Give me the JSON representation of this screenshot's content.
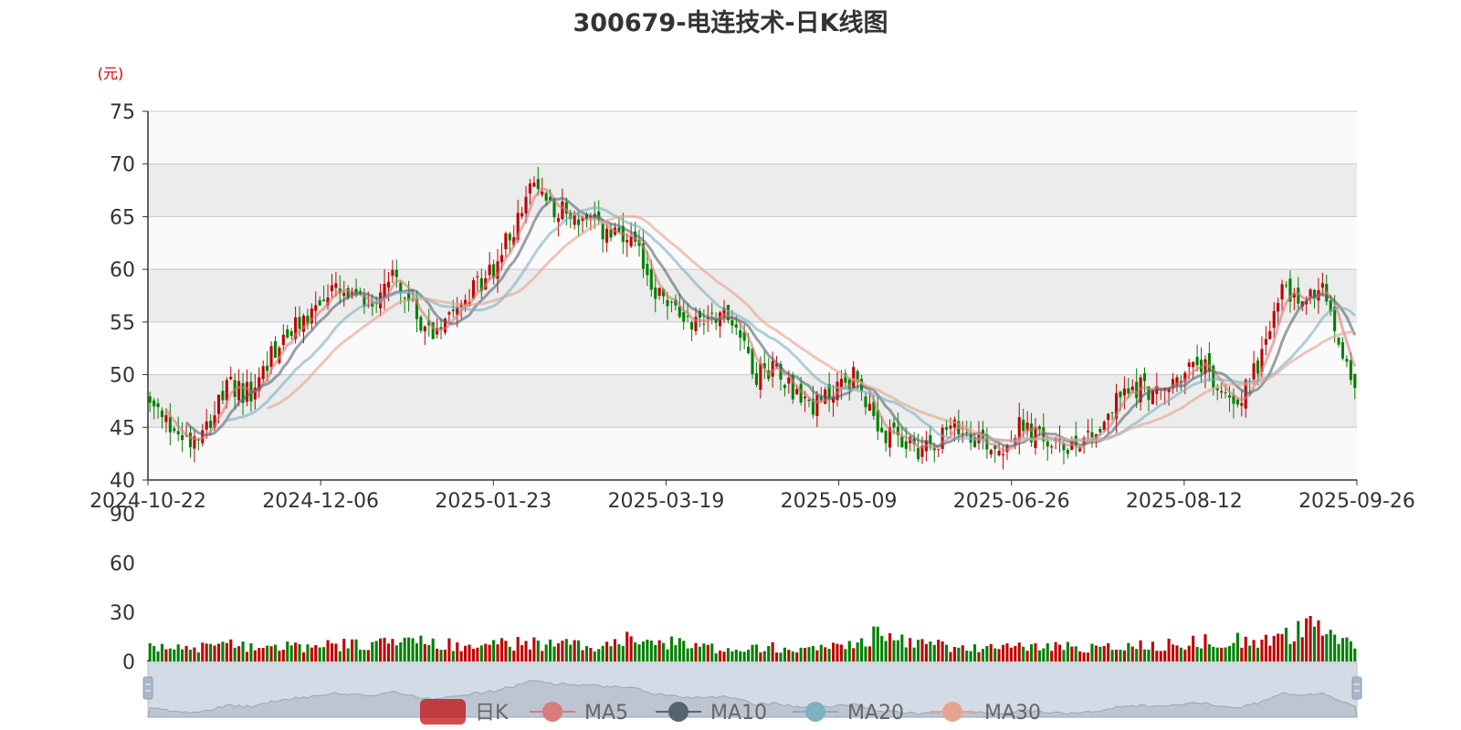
{
  "chart_data": {
    "type": "candlestick",
    "title": "300679-电连技术-日K线图",
    "price_unit": "(元)",
    "price_axis": {
      "ylim": [
        40,
        75
      ],
      "ticks": [
        40,
        45,
        50,
        55,
        60,
        65,
        70,
        75
      ]
    },
    "volume_axis": {
      "ylim": [
        0,
        90
      ],
      "ticks": [
        0,
        30,
        60,
        90
      ]
    },
    "x_ticks": [
      "2024-10-22",
      "2024-12-06",
      "2025-01-23",
      "2025-03-19",
      "2025-05-09",
      "2025-06-26",
      "2025-08-12",
      "2025-09-26"
    ],
    "legend": [
      "日K",
      "MA5",
      "MA10",
      "MA20",
      "MA30"
    ],
    "colors": {
      "up": "#c00000",
      "down": "#008000",
      "MA5": "#d87c7c",
      "MA10": "#546570",
      "MA20": "#7eb0bf",
      "MA30": "#e5a48d",
      "grid_band": "#ececec",
      "axis": "#333333",
      "title": "#333333",
      "unit": "#d00000",
      "zoom_bg": "#d3dbe6"
    },
    "grid": true,
    "legend_position": "bottom-center",
    "close_series_anchors": [
      [
        0,
        47
      ],
      [
        5,
        45
      ],
      [
        10,
        44
      ],
      [
        15,
        46
      ],
      [
        20,
        49
      ],
      [
        25,
        48
      ],
      [
        30,
        52
      ],
      [
        35,
        54
      ],
      [
        40,
        56
      ],
      [
        45,
        58
      ],
      [
        50,
        57
      ],
      [
        55,
        57
      ],
      [
        60,
        60
      ],
      [
        65,
        56
      ],
      [
        70,
        54
      ],
      [
        75,
        57
      ],
      [
        80,
        58
      ],
      [
        85,
        60
      ],
      [
        90,
        64
      ],
      [
        95,
        68
      ],
      [
        100,
        66
      ],
      [
        105,
        65
      ],
      [
        110,
        64
      ],
      [
        115,
        63
      ],
      [
        120,
        62
      ],
      [
        125,
        58
      ],
      [
        130,
        56
      ],
      [
        135,
        55
      ],
      [
        140,
        56
      ],
      [
        145,
        55
      ],
      [
        150,
        50
      ],
      [
        155,
        51
      ],
      [
        160,
        48
      ],
      [
        165,
        47
      ],
      [
        170,
        49
      ],
      [
        175,
        50
      ],
      [
        180,
        44
      ],
      [
        185,
        44
      ],
      [
        190,
        43
      ],
      [
        195,
        44
      ],
      [
        200,
        45
      ],
      [
        205,
        44
      ],
      [
        210,
        43
      ],
      [
        215,
        45
      ],
      [
        220,
        44
      ],
      [
        225,
        43
      ],
      [
        230,
        44
      ],
      [
        235,
        45
      ],
      [
        240,
        48
      ],
      [
        245,
        49
      ],
      [
        250,
        48
      ],
      [
        255,
        50
      ],
      [
        260,
        51
      ],
      [
        265,
        48
      ],
      [
        270,
        48
      ],
      [
        275,
        52
      ],
      [
        280,
        58
      ],
      [
        285,
        57
      ],
      [
        290,
        58
      ],
      [
        295,
        52
      ],
      [
        298,
        49
      ]
    ],
    "volume_anchors": [
      [
        0,
        8
      ],
      [
        20,
        10
      ],
      [
        40,
        9
      ],
      [
        60,
        12
      ],
      [
        80,
        10
      ],
      [
        90,
        11
      ],
      [
        110,
        10
      ],
      [
        120,
        14
      ],
      [
        140,
        8
      ],
      [
        150,
        9
      ],
      [
        170,
        9
      ],
      [
        180,
        16
      ],
      [
        200,
        8
      ],
      [
        220,
        9
      ],
      [
        240,
        9
      ],
      [
        260,
        12
      ],
      [
        280,
        14
      ],
      [
        285,
        22
      ],
      [
        298,
        9
      ]
    ],
    "num_bars": 299
  }
}
